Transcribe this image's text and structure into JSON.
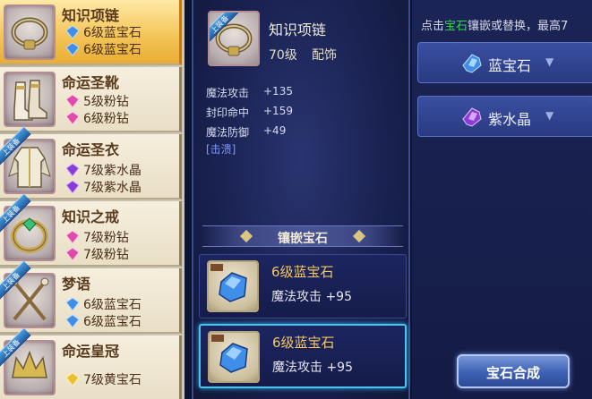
{
  "equipment_list": {
    "items": [
      {
        "name": "知识项链",
        "badge": "",
        "gems": [
          {
            "label": "6级蓝宝石",
            "gem": "sapphire"
          },
          {
            "label": "6级蓝宝石",
            "gem": "sapphire"
          }
        ],
        "selected": true
      },
      {
        "name": "命运圣靴",
        "badge": "",
        "gems": [
          {
            "label": "5级粉钻",
            "gem": "pink-diamond"
          },
          {
            "label": "6级粉钻",
            "gem": "pink-diamond"
          }
        ],
        "selected": false
      },
      {
        "name": "命运圣衣",
        "badge": "上装备",
        "gems": [
          {
            "label": "7级紫水晶",
            "gem": "amethyst"
          },
          {
            "label": "7级紫水晶",
            "gem": "amethyst"
          }
        ],
        "selected": false
      },
      {
        "name": "知识之戒",
        "badge": "上装备",
        "gems": [
          {
            "label": "7级粉钻",
            "gem": "pink-diamond"
          },
          {
            "label": "7级粉钻",
            "gem": "pink-diamond"
          }
        ],
        "selected": false
      },
      {
        "name": "梦语",
        "badge": "上装备",
        "gems": [
          {
            "label": "6级蓝宝石",
            "gem": "sapphire"
          },
          {
            "label": "6级蓝宝石",
            "gem": "sapphire"
          }
        ],
        "selected": false
      },
      {
        "name": "命运皇冠",
        "badge": "上装备",
        "gems": [
          {
            "label": "7级黄宝石",
            "gem": "topaz"
          }
        ],
        "selected": false
      }
    ]
  },
  "detail": {
    "badge": "上装备",
    "name": "知识项链",
    "level": "70级",
    "type": "配饰",
    "stats": [
      {
        "label": "魔法攻击",
        "value": "+135"
      },
      {
        "label": "封印命中",
        "value": "+159"
      },
      {
        "label": "魔法防御",
        "value": "+49"
      }
    ],
    "quality": "[击溃]",
    "section_title": "镶嵌宝石",
    "slots": [
      {
        "name": "6级蓝宝石",
        "attr": "魔法攻击 +95",
        "active": false
      },
      {
        "name": "6级蓝宝石",
        "attr": "魔法攻击 +95",
        "active": true
      }
    ]
  },
  "right_panel": {
    "hint_prefix": "点击",
    "hint_highlight": "宝石",
    "hint_suffix": "镶嵌或替换，最高7",
    "gem_buttons": [
      {
        "label": "蓝宝石",
        "icon": "sapphire-icon",
        "arrow": "▼"
      },
      {
        "label": "紫水晶",
        "icon": "amethyst-icon",
        "arrow": "▼"
      }
    ],
    "synth_button": "宝石合成"
  },
  "colors": {
    "sapphire": "#3f8ee8",
    "pink_diamond": "#e04aa8",
    "amethyst": "#8a3cd8",
    "topaz": "#e8c030",
    "gem_name": "#f4c860",
    "hint_highlight": "#37d24a",
    "active_slot_border": "#48c6ee"
  }
}
